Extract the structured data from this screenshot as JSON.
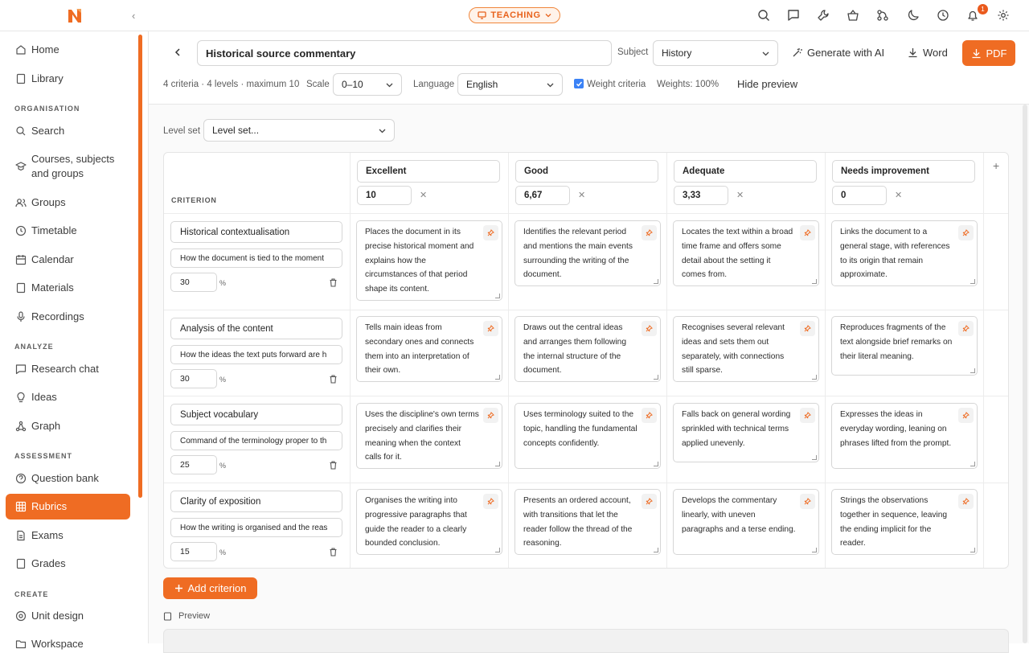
{
  "topbar": {
    "mode_label": "TEACHING",
    "notification_count": "1",
    "icons": [
      "search-icon",
      "chat-icon",
      "wrench-icon",
      "bag-icon",
      "flask-icon",
      "moon-icon",
      "clock-icon",
      "bell-icon",
      "gear-icon"
    ]
  },
  "sidebar": {
    "items_top": [
      {
        "label": "Home",
        "icon": "home-icon"
      },
      {
        "label": "Library",
        "icon": "book-icon"
      }
    ],
    "sections": [
      {
        "title": "ORGANISATION",
        "items": [
          {
            "label": "Search"
          },
          {
            "label": "Courses, subjects and groups"
          },
          {
            "label": "Groups"
          },
          {
            "label": "Timetable"
          },
          {
            "label": "Calendar"
          },
          {
            "label": "Materials"
          },
          {
            "label": "Recordings"
          }
        ]
      },
      {
        "title": "ANALYZE",
        "items": [
          {
            "label": "Research chat"
          },
          {
            "label": "Ideas"
          },
          {
            "label": "Graph"
          }
        ]
      },
      {
        "title": "ASSESSMENT",
        "items": [
          {
            "label": "Question bank"
          },
          {
            "label": "Rubrics",
            "active": true
          },
          {
            "label": "Exams"
          },
          {
            "label": "Grades"
          }
        ]
      },
      {
        "title": "CREATE",
        "items": [
          {
            "label": "Unit design"
          },
          {
            "label": "Workspace"
          }
        ]
      }
    ]
  },
  "header": {
    "title_value": "Historical source commentary",
    "subject_label": "Subject",
    "subject_value": "History",
    "generate_label": "Generate with AI",
    "word_label": "Word",
    "pdf_label": "PDF",
    "summary": "4 criteria · 4 levels · maximum 10",
    "scale_label": "Scale",
    "scale_value": "0–10",
    "language_label": "Language",
    "language_value": "English",
    "weight_label": "Weight criteria",
    "weight_checked": true,
    "weights_text": "Weights: 100%",
    "hide_preview": "Hide preview"
  },
  "levelset": {
    "label": "Level set",
    "value": "Level set..."
  },
  "table": {
    "criterion_header": "CRITERION",
    "levels": [
      {
        "name": "Excellent",
        "score": "10"
      },
      {
        "name": "Good",
        "score": "6,67"
      },
      {
        "name": "Adequate",
        "score": "3,33"
      },
      {
        "name": "Needs improvement",
        "score": "0"
      }
    ],
    "criteria": [
      {
        "name": "Historical contextualisation",
        "desc": "How the document is tied to the moment",
        "weight": "30",
        "cells": [
          "Places the document in its precise historical moment and explains how the circumstances of that period shape its content.",
          "Identifies the relevant period and mentions the main events surrounding the writing of the document.",
          "Locates the text within a broad time frame and offers some detail about the setting it comes from.",
          "Links the document to a general stage, with references to its origin that remain approximate."
        ]
      },
      {
        "name": "Analysis of the content",
        "desc": "How the ideas the text puts forward are h",
        "weight": "30",
        "cells": [
          "Tells main ideas from secondary ones and connects them into an interpretation of their own.",
          "Draws out the central ideas and arranges them following the internal structure of the document.",
          "Recognises several relevant ideas and sets them out separately, with connections still sparse.",
          "Reproduces fragments of the text alongside brief remarks on their literal meaning."
        ]
      },
      {
        "name": "Subject vocabulary",
        "desc": "Command of the terminology proper to th",
        "weight": "25",
        "cells": [
          "Uses the discipline's own terms precisely and clarifies their meaning when the context calls for it.",
          "Uses terminology suited to the topic, handling the fundamental concepts confidently.",
          "Falls back on general wording sprinkled with technical terms applied unevenly.",
          "Expresses the ideas in everyday wording, leaning on phrases lifted from the prompt."
        ]
      },
      {
        "name": "Clarity of exposition",
        "desc": "How the writing is organised and the reas",
        "weight": "15",
        "cells": [
          "Organises the writing into progressive paragraphs that guide the reader to a clearly bounded conclusion.",
          "Presents an ordered account, with transitions that let the reader follow the thread of the reasoning.",
          "Develops the commentary linearly, with uneven paragraphs and a terse ending.",
          "Strings the observations together in sequence, leaving the ending implicit for the reader."
        ]
      }
    ],
    "percent_sign": "%",
    "add_level": "+"
  },
  "add_criterion_label": "Add criterion",
  "preview_label": "Preview",
  "colors": {
    "accent": "#ef6c23"
  }
}
